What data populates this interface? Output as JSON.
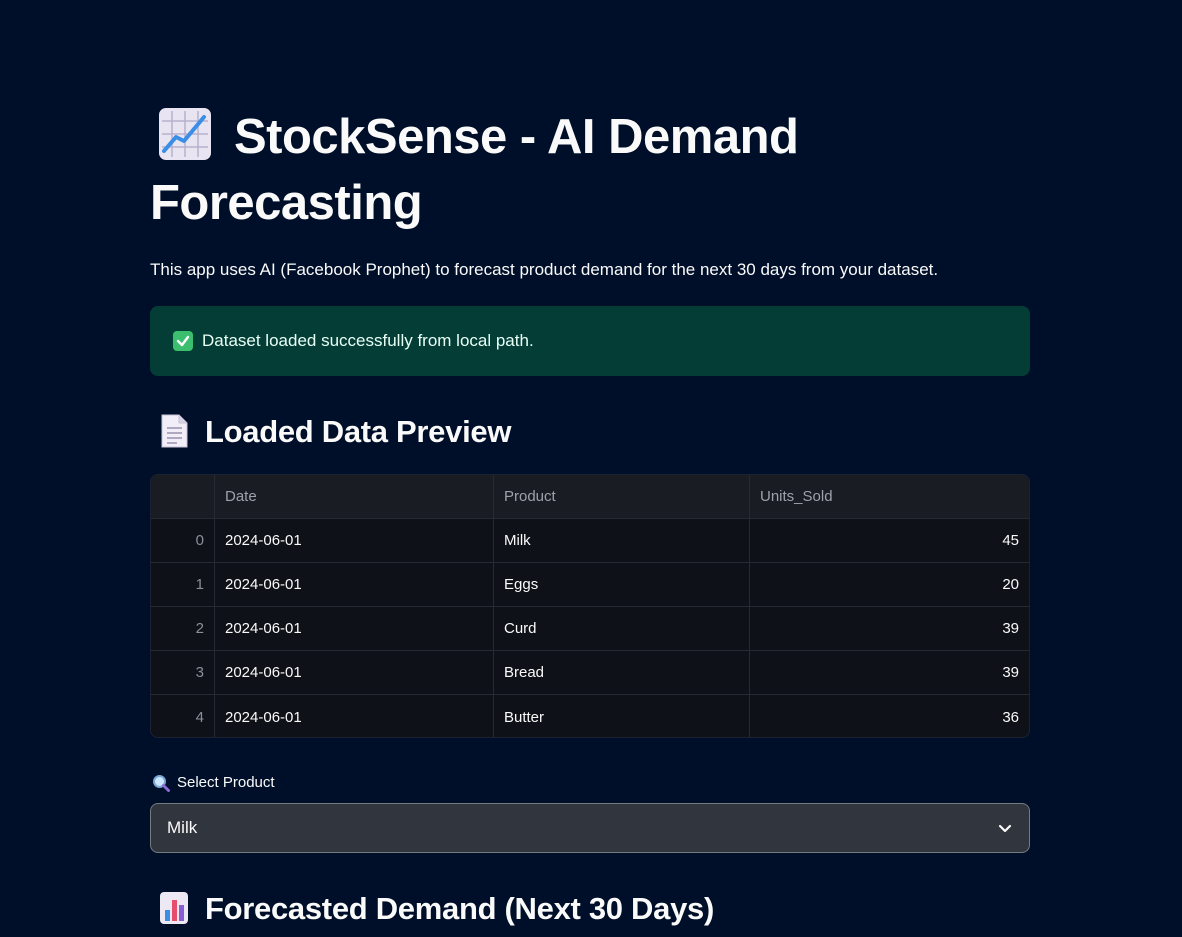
{
  "title": {
    "icon": "chart-increasing-icon",
    "text": "StockSense - AI Demand Forecasting"
  },
  "subtitle": "This app uses AI (Facebook Prophet) to forecast product demand for the next 30 days from your dataset.",
  "alert": {
    "icon": "check-mark-icon",
    "text": "Dataset loaded successfully from local path."
  },
  "preview": {
    "icon": "document-icon",
    "heading": "Loaded Data Preview",
    "columns": [
      "",
      "Date",
      "Product",
      "Units_Sold"
    ],
    "rows": [
      {
        "idx": "0",
        "date": "2024-06-01",
        "product": "Milk",
        "units": "45"
      },
      {
        "idx": "1",
        "date": "2024-06-01",
        "product": "Eggs",
        "units": "20"
      },
      {
        "idx": "2",
        "date": "2024-06-01",
        "product": "Curd",
        "units": "39"
      },
      {
        "idx": "3",
        "date": "2024-06-01",
        "product": "Bread",
        "units": "39"
      },
      {
        "idx": "4",
        "date": "2024-06-01",
        "product": "Butter",
        "units": "36"
      }
    ]
  },
  "select": {
    "icon": "magnifying-glass-icon",
    "label": "Select Product",
    "value": "Milk"
  },
  "forecast": {
    "icon": "bar-chart-icon",
    "heading": "Forecasted Demand (Next 30 Days)"
  },
  "colors": {
    "background": "#000f29",
    "alert_bg": "#033d36",
    "table_bg": "#0e1117"
  }
}
